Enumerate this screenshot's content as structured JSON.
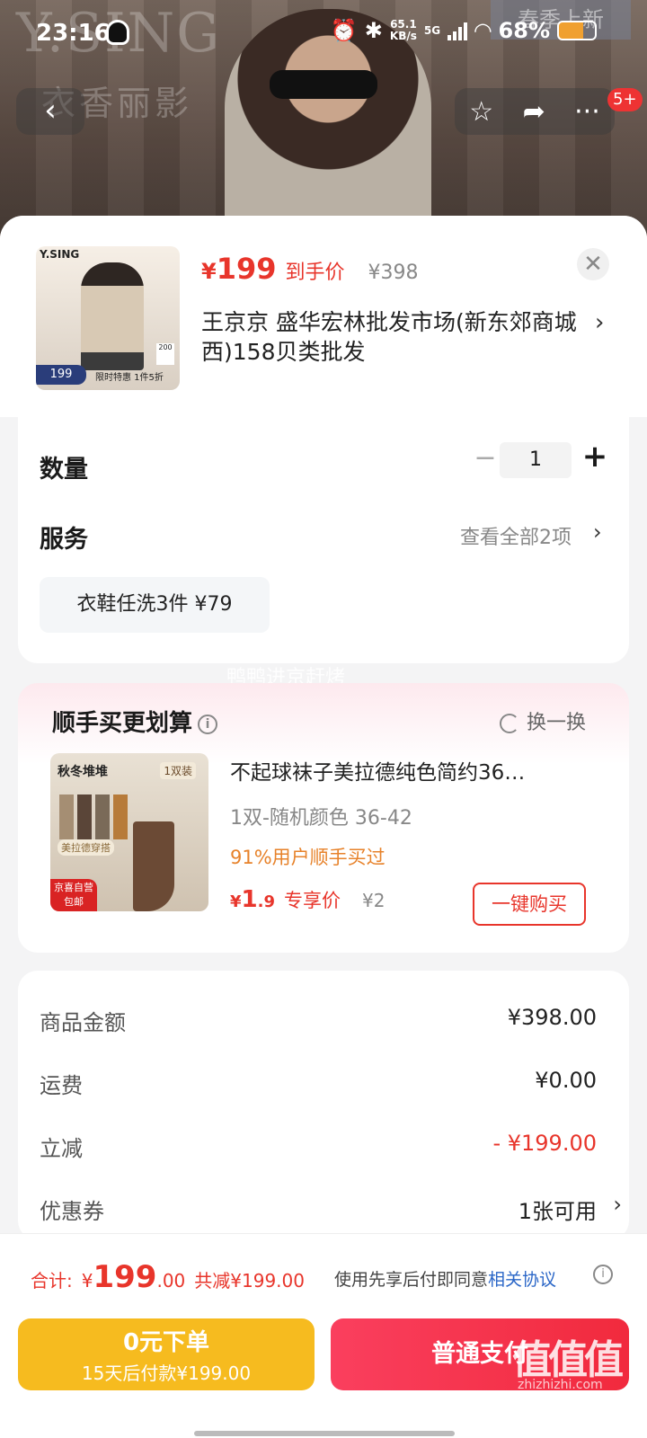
{
  "status_bar": {
    "time": "23:16",
    "net_speed_value": "65.1",
    "net_speed_unit": "KB/s",
    "network": "5G",
    "battery": "68%"
  },
  "hero": {
    "brand": "Y.SING",
    "brand_sub": "衣香丽影",
    "spring_tag": "春季上新",
    "cart_badge": "5+"
  },
  "product": {
    "thumb_brand": "Y.SING",
    "thumb_price": "199",
    "thumb_sale": "限时特惠 1件5折",
    "thumb_count": "200",
    "price_yen": "¥",
    "price": "199",
    "price_tag": "到手价",
    "original_price": "¥398",
    "store": "王京京  盛华宏林批发市场(新东郊商城西)158贝类批发"
  },
  "quantity": {
    "label": "数量",
    "minus": "−",
    "value": "1",
    "plus": "+"
  },
  "service": {
    "label": "服务",
    "view_all": "查看全部2项",
    "chip": "衣鞋任洗3件  ¥79"
  },
  "watermark": "鸭鸭进京赶烤",
  "upsell": {
    "title": "顺手买更划算",
    "swap": "换一换",
    "img_title": "秋冬堆堆",
    "img_pack": "1双装",
    "img_note": "美拉德穿搭",
    "img_badge_1": "京喜自营",
    "img_badge_2": "包邮",
    "name": "不起球袜子美拉德纯色简约36…",
    "spec": "1双-随机颜色   36-42",
    "popularity": "91%用户顺手买过",
    "price_yen": "¥",
    "price_int": "1",
    "price_dec": ".9",
    "price_tag": "专享价",
    "original_price": "¥2",
    "buy_button": "一键购买"
  },
  "summary": {
    "rows": [
      {
        "label": "商品金额",
        "value": "¥398.00"
      },
      {
        "label": "运费",
        "value": "¥0.00"
      },
      {
        "label": "立减",
        "value": "- ¥199.00"
      },
      {
        "label": "优惠券",
        "value": "1张可用"
      }
    ]
  },
  "footer": {
    "total_label": "合计:",
    "total_yen": "¥",
    "total_int": "199",
    "total_dec": ".00",
    "total_saved": "共减¥199.00",
    "agree_text": "使用先享后付即同意",
    "agree_link": "相关协议",
    "later_line1": "0元下单",
    "later_line2": "15天后付款¥199.00",
    "pay_button": "普通支付",
    "logo": "值值值",
    "logo_url": "zhizhizhi.com"
  },
  "colors": {
    "accent_red": "#e8352b",
    "pay_button": "#f12a3d",
    "later_button": "#f6bb1f",
    "link_blue": "#2a66c7",
    "popularity_orange": "#e7822a"
  }
}
